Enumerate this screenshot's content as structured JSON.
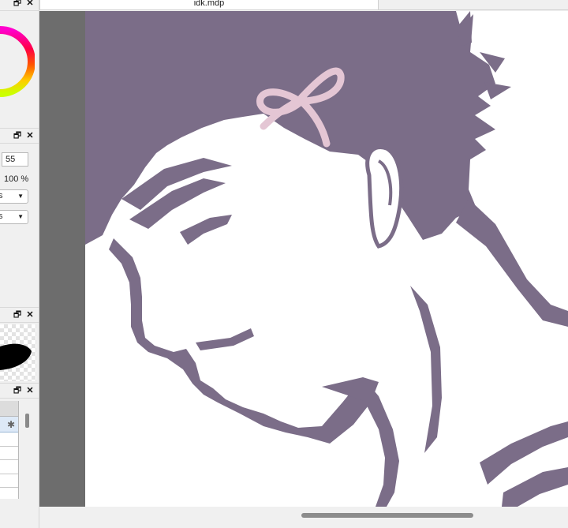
{
  "document": {
    "tab_title": "idk.mdp"
  },
  "panel_controls": {
    "restore_icon": "restore-window-icon",
    "restore_glyph": "🗗",
    "close_icon": "close-icon",
    "close_glyph": "✕"
  },
  "brush": {
    "size_value": "55",
    "opacity_value": "100 %"
  },
  "dropdowns": [
    {
      "text": "s",
      "chevron": "▼"
    },
    {
      "text": "s",
      "chevron": "▼"
    }
  ],
  "layers": {
    "settings_glyph": "✱"
  },
  "colors": {
    "hair": "#7b6d88",
    "ribbon": "#e4c6d4",
    "canvas_bg": "#6d6d6d",
    "paper": "#ffffff",
    "ui_bg": "#f0f0f0"
  }
}
